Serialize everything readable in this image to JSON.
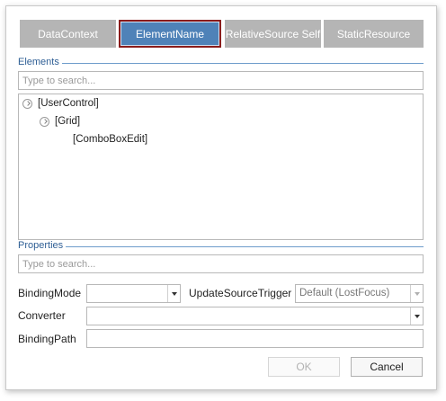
{
  "tabs": [
    {
      "label": "DataContext",
      "active": false
    },
    {
      "label": "ElementName",
      "active": true
    },
    {
      "label": "RelativeSource Self",
      "active": false
    },
    {
      "label": "StaticResource",
      "active": false
    }
  ],
  "elements": {
    "label": "Elements",
    "search_placeholder": "Type to search...",
    "tree": [
      {
        "label": "[UserControl]",
        "expanded": true
      },
      {
        "label": "[Grid]",
        "expanded": true
      },
      {
        "label": "[ComboBoxEdit]",
        "expanded": false
      }
    ]
  },
  "properties": {
    "label": "Properties",
    "search_placeholder": "Type to search..."
  },
  "form": {
    "binding_mode_label": "BindingMode",
    "binding_mode_value": "",
    "update_trigger_label": "UpdateSourceTrigger",
    "update_trigger_value": "Default (LostFocus)",
    "converter_label": "Converter",
    "converter_value": "",
    "binding_path_label": "BindingPath",
    "binding_path_value": ""
  },
  "buttons": {
    "ok": "OK",
    "cancel": "Cancel"
  },
  "colors": {
    "active_tab": "#4f82b8",
    "active_tab_border": "#8a1c1c",
    "inactive_tab": "#b5b5b5",
    "section_label": "#2f5f95"
  },
  "icons": {
    "tree_toggle": "collapse-circle-icon",
    "dropdown": "chevron-down-icon"
  }
}
